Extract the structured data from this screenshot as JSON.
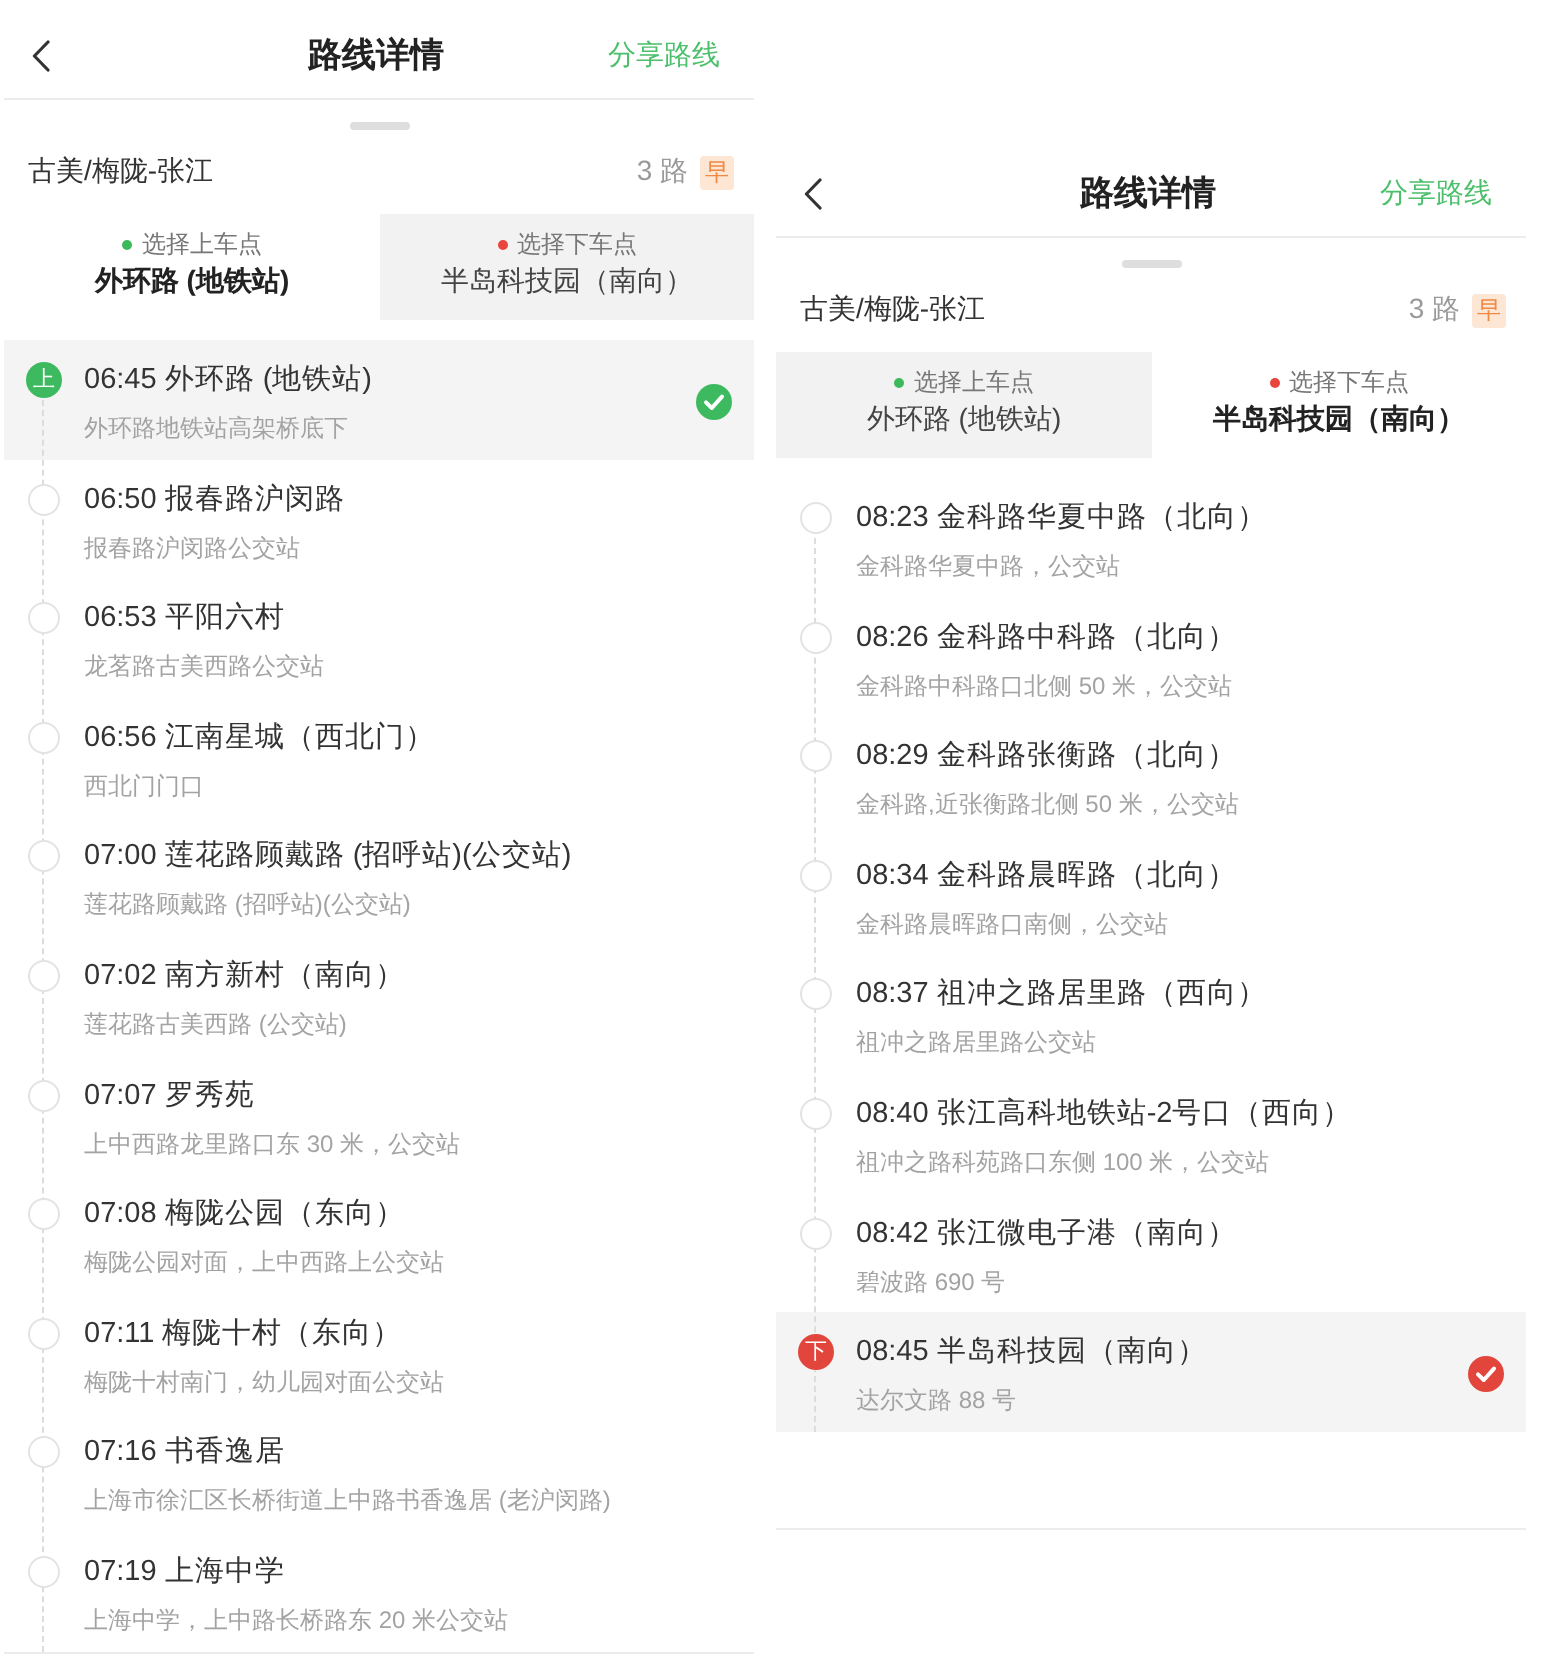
{
  "screens": [
    {
      "header": {
        "title": "路线详情",
        "action": "分享路线"
      },
      "route": {
        "name": "古美/梅陇-张江",
        "number": "3 路",
        "badge": "早"
      },
      "tabs": [
        {
          "label": "选择上车点",
          "value": "外环路 (地铁站)",
          "color": "#3cb95a",
          "selected": true
        },
        {
          "label": "选择下车点",
          "value": "半岛科技园（南向）",
          "color": "#e8453c",
          "selected": false
        }
      ],
      "stops": [
        {
          "kind": "board",
          "marker": "上",
          "title": "06:45 外环路 (地铁站)",
          "address": "外环路地铁站高架桥底下",
          "selected": true
        },
        {
          "kind": "stop",
          "title": "06:50 报春路沪闵路",
          "address": "报春路沪闵路公交站",
          "selected": false
        },
        {
          "kind": "stop",
          "title": "06:53 平阳六村",
          "address": "龙茗路古美西路公交站",
          "selected": false
        },
        {
          "kind": "stop",
          "title": "06:56 江南星城（西北门）",
          "address": "西北门门口",
          "selected": false
        },
        {
          "kind": "stop",
          "title": "07:00 莲花路顾戴路 (招呼站)(公交站)",
          "address": "莲花路顾戴路 (招呼站)(公交站)",
          "selected": false
        },
        {
          "kind": "stop",
          "title": "07:02 南方新村（南向）",
          "address": "莲花路古美西路 (公交站)",
          "selected": false
        },
        {
          "kind": "stop",
          "title": "07:07 罗秀苑",
          "address": "上中西路龙里路口东 30 米，公交站",
          "selected": false
        },
        {
          "kind": "stop",
          "title": "07:08 梅陇公园（东向）",
          "address": "梅陇公园对面，上中西路上公交站",
          "selected": false
        },
        {
          "kind": "stop",
          "title": "07:11 梅陇十村（东向）",
          "address": "梅陇十村南门，幼儿园对面公交站",
          "selected": false
        },
        {
          "kind": "stop",
          "title": "07:16 书香逸居",
          "address": "上海市徐汇区长桥街道上中路书香逸居 (老沪闵路)",
          "selected": false
        },
        {
          "kind": "stop",
          "title": "07:19 上海中学",
          "address": "上海中学，上中路长桥路东 20 米公交站",
          "selected": false
        }
      ]
    },
    {
      "header": {
        "title": "路线详情",
        "action": "分享路线"
      },
      "route": {
        "name": "古美/梅陇-张江",
        "number": "3 路",
        "badge": "早"
      },
      "tabs": [
        {
          "label": "选择上车点",
          "value": "外环路 (地铁站)",
          "color": "#3cb95a",
          "selected": false
        },
        {
          "label": "选择下车点",
          "value": "半岛科技园（南向）",
          "color": "#e8453c",
          "selected": true
        }
      ],
      "stops": [
        {
          "kind": "stop",
          "title": "08:23 金科路华夏中路（北向）",
          "address": "金科路华夏中路，公交站",
          "selected": false
        },
        {
          "kind": "stop",
          "title": "08:26 金科路中科路（北向）",
          "address": "金科路中科路口北侧 50 米，公交站",
          "selected": false
        },
        {
          "kind": "stop",
          "title": "08:29 金科路张衡路（北向）",
          "address": "金科路,近张衡路北侧 50 米，公交站",
          "selected": false
        },
        {
          "kind": "stop",
          "title": "08:34 金科路晨晖路（北向）",
          "address": "金科路晨晖路口南侧，公交站",
          "selected": false
        },
        {
          "kind": "stop",
          "title": "08:37 祖冲之路居里路（西向）",
          "address": "祖冲之路居里路公交站",
          "selected": false
        },
        {
          "kind": "stop",
          "title": "08:40 张江高科地铁站-2号口（西向）",
          "address": "祖冲之路科苑路口东侧 100 米，公交站",
          "selected": false
        },
        {
          "kind": "stop",
          "title": "08:42 张江微电子港（南向）",
          "address": "碧波路 690 号",
          "selected": false
        },
        {
          "kind": "alight",
          "marker": "下",
          "title": "08:45 半岛科技园（南向）",
          "address": "达尔文路 88 号",
          "selected": true
        }
      ]
    }
  ]
}
